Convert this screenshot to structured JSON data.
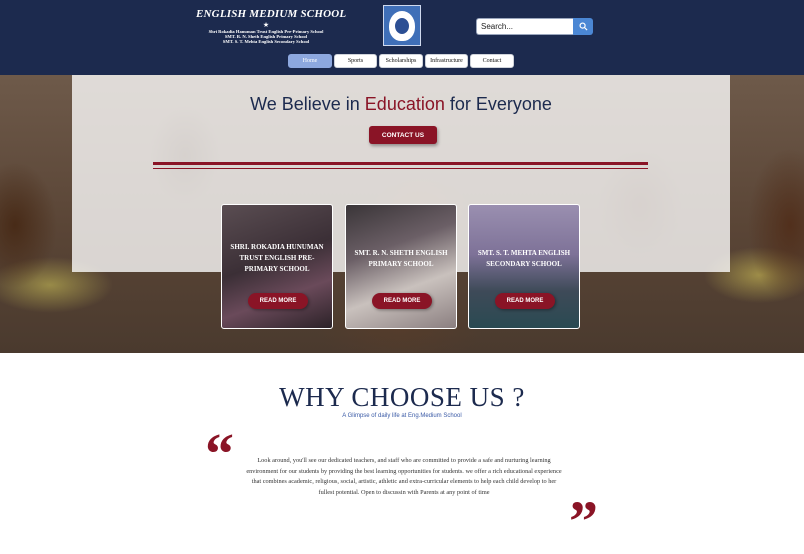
{
  "header": {
    "logo_title": "ENGLISH MEDIUM SCHOOL",
    "logo_star": "★",
    "logo_lines": [
      "Shri Rokadia Hanuman Trust English Pre-Primary School",
      "SMT. R. N. Sheth English Primary School",
      "SMT. S. T. Mehta English Secondary School"
    ],
    "search_placeholder": "Search...",
    "colors": {
      "bar": "#1c2a4e",
      "search_button": "#4b87d4"
    }
  },
  "nav": {
    "items": [
      "Home",
      "Sports",
      "Scholarships",
      "Infrastructure",
      "Contact"
    ],
    "active": "Home"
  },
  "hero": {
    "title_before": "We Believe in ",
    "title_accent": "Education",
    "title_after": " for Everyone",
    "contact_button": "CONTACT US",
    "accent_color": "#8a1426"
  },
  "cards": [
    {
      "title": "SHRI. ROKADIA HUNUMAN TRUST ENGLISH PRE-PRIMARY SCHOOL",
      "button": "READ MORE"
    },
    {
      "title": "SMT. R. N. SHETH ENGLISH PRIMARY SCHOOL",
      "button": "READ MORE"
    },
    {
      "title": "SMT. S. T. MEHTA ENGLISH SECONDARY SCHOOL",
      "button": "READ MORE"
    }
  ],
  "why": {
    "title": "WHY CHOOSE US ?",
    "subtitle": "A Glimpse of daily life at Eng.Medium School",
    "quote_open": "“",
    "quote_close": "”",
    "body": "Look around, you'll see our dedicated  teachers, and staff who are  committed to provide a safe and nurturing learning environment for our students by providing the best learning opportunities for students.  we offer a rich educational experience that combines academic, religious, social, artistic, athletic and extra-curricular elements to help each child develop to her fullest potential. Open to discussin with Parents at any point of time"
  }
}
